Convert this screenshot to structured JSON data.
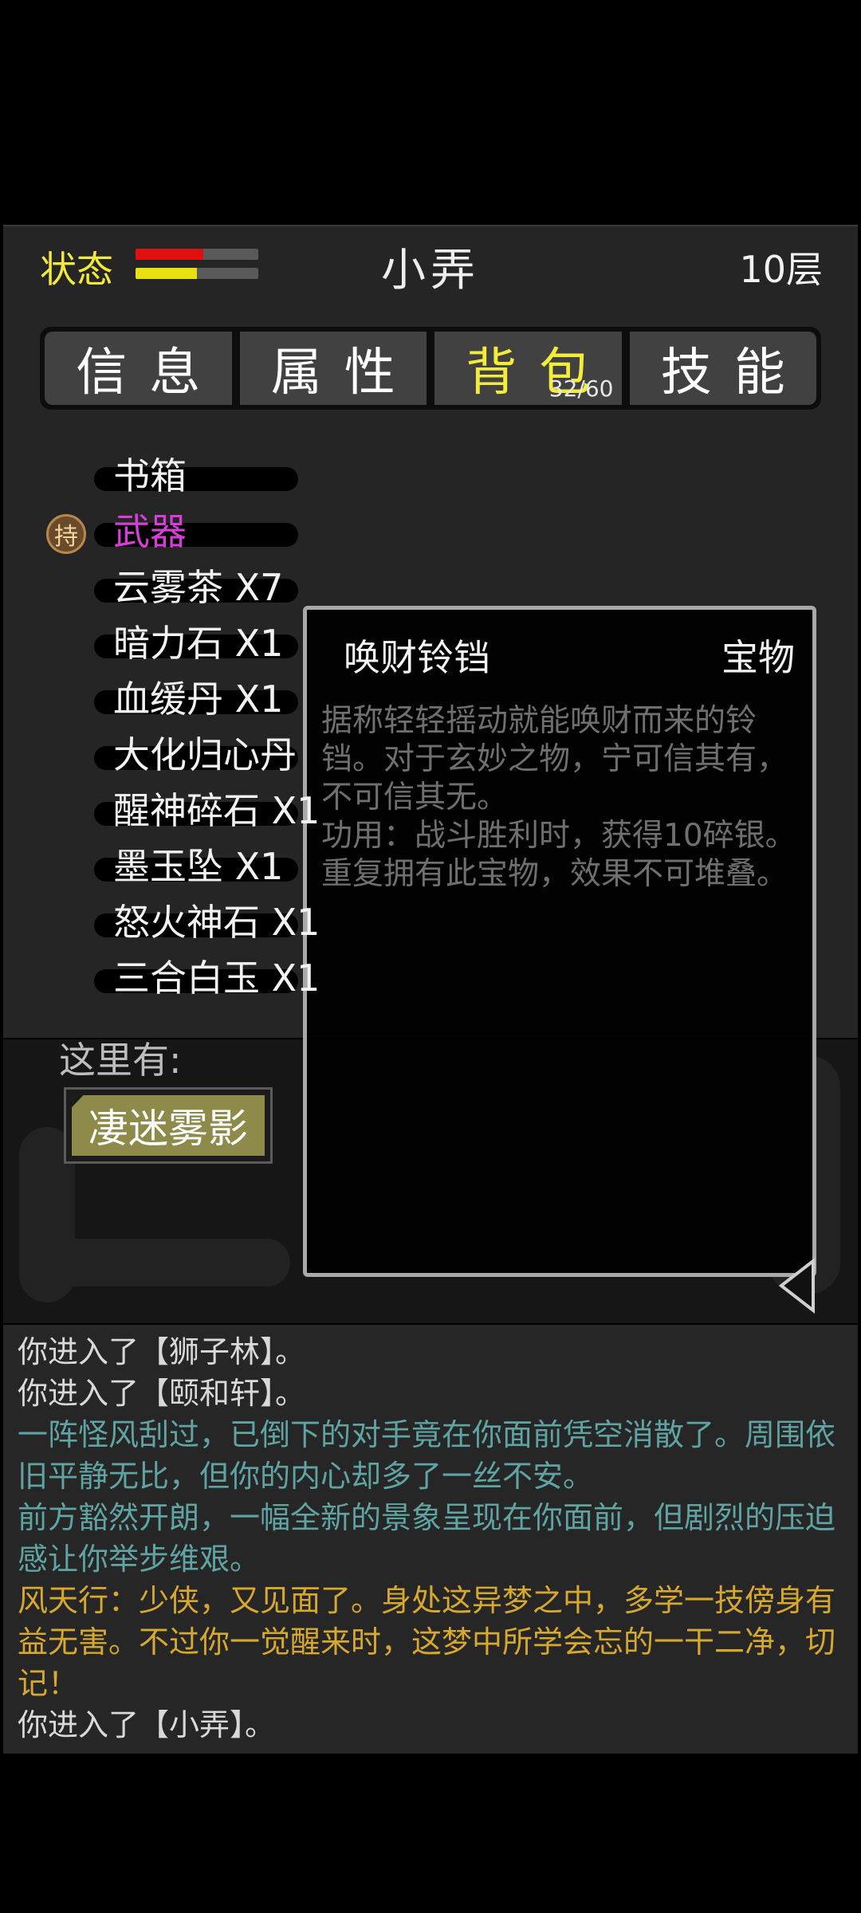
{
  "header": {
    "status_label": "状态",
    "hp_fraction": 0.55,
    "mp_fraction": 0.5,
    "hp_color": "#e01010",
    "mp_color": "#e8e010",
    "location": "小弄",
    "floor": "10层"
  },
  "tabs": [
    {
      "label": "信息",
      "active": false
    },
    {
      "label": "属性",
      "active": false
    },
    {
      "label": "背包",
      "active": true,
      "count": "32/60"
    },
    {
      "label": "技能",
      "active": false
    }
  ],
  "inventory": {
    "held_badge": "持",
    "items": [
      {
        "label": "书箱",
        "equipped": false
      },
      {
        "label": "武器",
        "equipped": true
      },
      {
        "label": "云雾茶 X7",
        "equipped": false
      },
      {
        "label": "暗力石 X1",
        "equipped": false
      },
      {
        "label": "血缓丹 X1",
        "equipped": false
      },
      {
        "label": "大化归心丹",
        "equipped": false
      },
      {
        "label": "醒神碎石 X1",
        "equipped": false
      },
      {
        "label": "墨玉坠 X1",
        "equipped": false
      },
      {
        "label": "怒火神石 X1",
        "equipped": false
      },
      {
        "label": "三合白玉 X1",
        "equipped": false
      }
    ]
  },
  "field": {
    "here_label": "这里有:",
    "npc": "凄迷雾影"
  },
  "tooltip": {
    "name": "唤财铃铛",
    "type": "宝物",
    "description": "据称轻轻摇动就能唤财而来的铃铛。对于玄妙之物，宁可信其有，不可信其无。",
    "effect": "功用：战斗胜利时，获得10碎银。重复拥有此宝物，效果不可堆叠。"
  },
  "colors": {
    "accent_yellow": "#f4ec3b",
    "equipped_purple": "#d63fd6",
    "log_cyan": "#5fa3a3",
    "log_gold": "#d6a830"
  },
  "log": [
    {
      "text": "你进入了【狮子林】。",
      "color": "white"
    },
    {
      "text": "你进入了【颐和轩】。",
      "color": "white"
    },
    {
      "text": "一阵怪风刮过，已倒下的对手竟在你面前凭空消散了。周围依旧平静无比，但你的内心却多了一丝不安。",
      "color": "cyan"
    },
    {
      "text": "前方豁然开朗，一幅全新的景象呈现在你面前，但剧烈的压迫感让你举步维艰。",
      "color": "cyan"
    },
    {
      "text": "风天行：少侠，又见面了。身处这异梦之中，多学一技傍身有益无害。不过你一觉醒来时，这梦中所学会忘的一干二净，切记！",
      "color": "gold"
    },
    {
      "text": "你进入了【小弄】。",
      "color": "white"
    }
  ]
}
